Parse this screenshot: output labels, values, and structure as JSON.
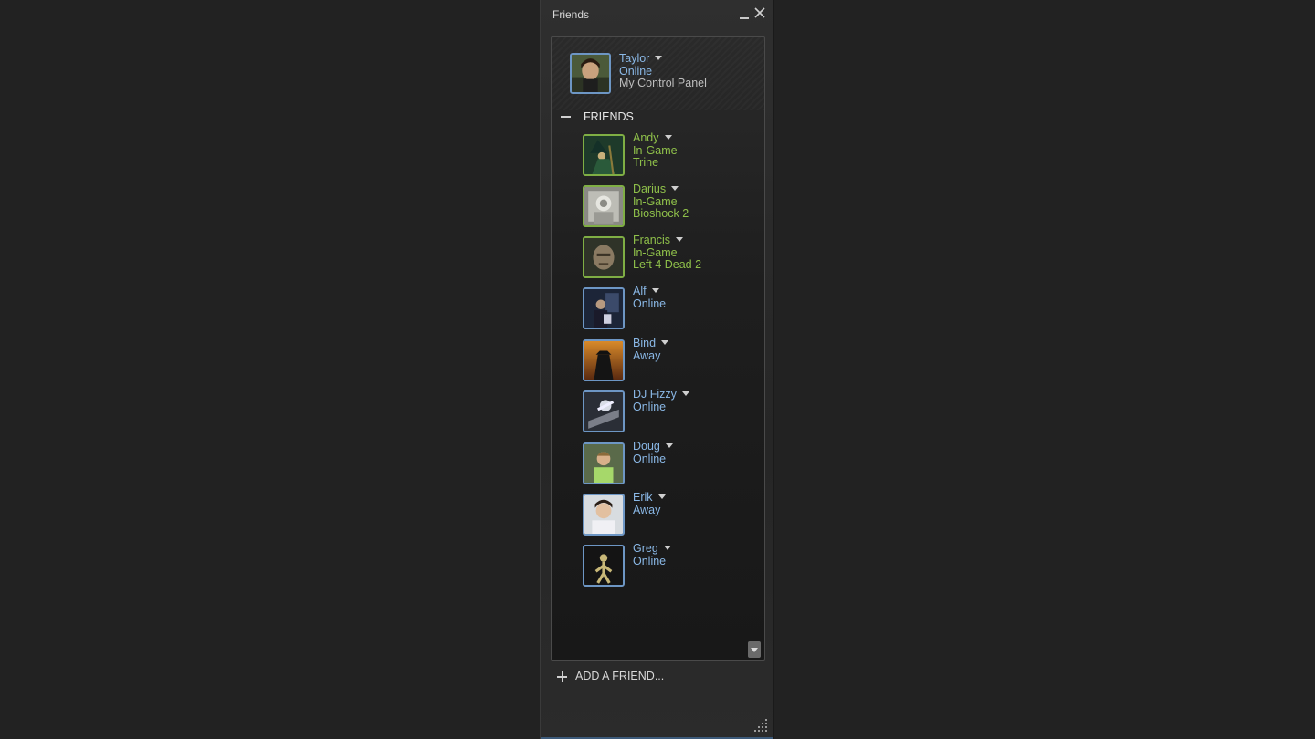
{
  "window": {
    "title": "Friends"
  },
  "me": {
    "name": "Taylor",
    "status": "Online",
    "control_panel": "My Control Panel"
  },
  "group": {
    "label": "FRIENDS"
  },
  "friends": [
    {
      "name": "Andy",
      "status": "In-Game",
      "game": "Trine",
      "state": "ingame"
    },
    {
      "name": "Darius",
      "status": "In-Game",
      "game": "Bioshock 2",
      "state": "ingame"
    },
    {
      "name": "Francis",
      "status": "In-Game",
      "game": "Left 4 Dead 2",
      "state": "ingame"
    },
    {
      "name": "Alf",
      "status": "Online",
      "state": "online"
    },
    {
      "name": "Bind",
      "status": "Away",
      "state": "online"
    },
    {
      "name": "DJ Fizzy",
      "status": "Online",
      "state": "online"
    },
    {
      "name": "Doug",
      "status": "Online",
      "state": "online"
    },
    {
      "name": "Erik",
      "status": "Away",
      "state": "online"
    },
    {
      "name": "Greg",
      "status": "Online",
      "state": "online"
    }
  ],
  "add_friend": {
    "label": "ADD A FRIEND..."
  },
  "colors": {
    "online": "#8ab8e6",
    "ingame": "#8fc04a",
    "online_border": "#6d96c4",
    "ingame_border": "#7fae44"
  }
}
